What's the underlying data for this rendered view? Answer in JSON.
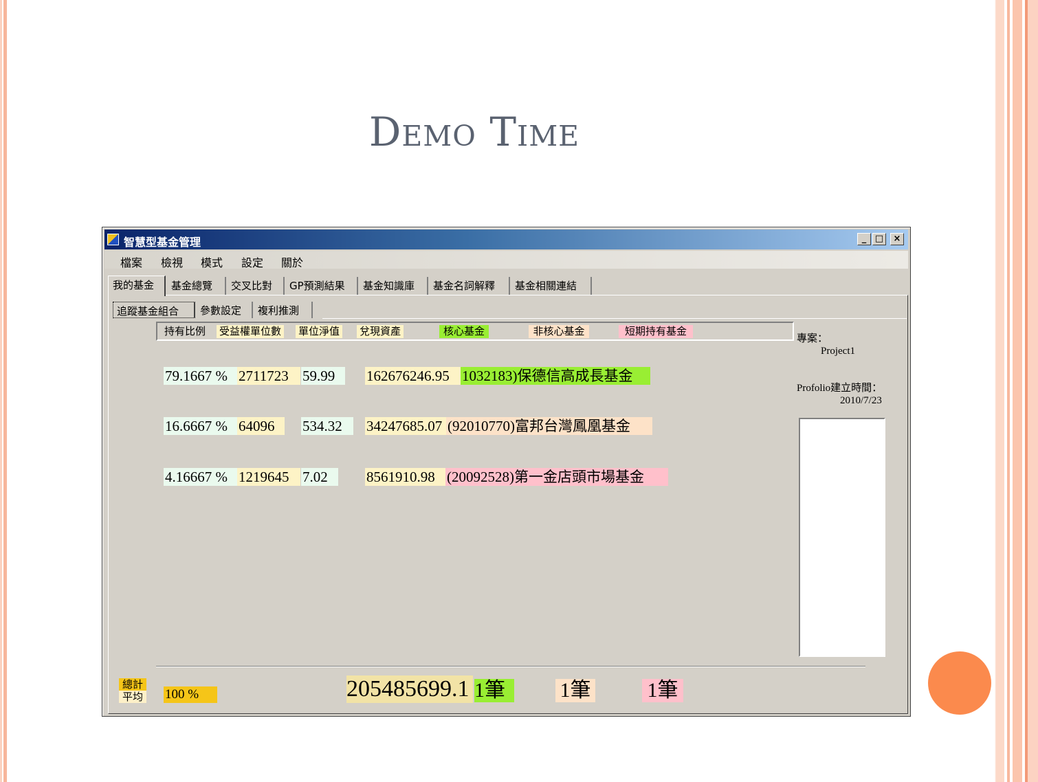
{
  "slide": {
    "title": "Demo Time"
  },
  "window": {
    "title": "智慧型基金管理",
    "min": "_",
    "max": "□",
    "close": "×"
  },
  "menu": [
    "檔案",
    "檢視",
    "模式",
    "設定",
    "關於"
  ],
  "main_tabs": [
    "我的基金",
    "基金總覽",
    "交叉比對",
    "GP預測結果",
    "基金知識庫",
    "基金名詞解釋",
    "基金相關連結"
  ],
  "sub_tabs": [
    "追蹤基金組合",
    "參數設定",
    "複利推測"
  ],
  "headers": {
    "ratio": "持有比例",
    "units": "受益權單位數",
    "nav": "單位淨值",
    "value": "兌現資產",
    "core": "核心基金",
    "noncore": "非核心基金",
    "short": "短期持有基金"
  },
  "rows": [
    {
      "ratio": "79.1667 %",
      "units": "2711723",
      "nav": "59.99",
      "value": "162676246.95",
      "fund": "1032183)保德信高成長基金",
      "category": "core"
    },
    {
      "ratio": "16.6667 %",
      "units": "64096",
      "nav": "534.32",
      "value": "34247685.07",
      "fund": "(92010770)富邦台灣鳳凰基金",
      "category": "noncore"
    },
    {
      "ratio": "4.16667 %",
      "units": "1219645",
      "nav": "7.02",
      "value": "8561910.98",
      "fund": "(20092528)第一金店頭市場基金",
      "category": "short"
    }
  ],
  "side": {
    "project_label": "專案：",
    "project_value": "Project1",
    "created_label": "Profolio建立時間：",
    "created_value": "2010/7/23"
  },
  "footer": {
    "total_label_1": "總計",
    "total_label_2": "平均",
    "percent": "100  %",
    "total_value": "205485699.1",
    "core_count": "1筆",
    "noncore_count": "1筆",
    "short_count": "1筆"
  },
  "colors": {
    "ratio_bg": "#eafaee",
    "units_bg": "#fdf3c6",
    "nav_bg": "#eafaee",
    "value_bg": "#fdf3c6",
    "core": "#99ee33",
    "noncore": "#fde2c8",
    "short": "#ffc0cb",
    "accent": "#fb8a4d"
  }
}
